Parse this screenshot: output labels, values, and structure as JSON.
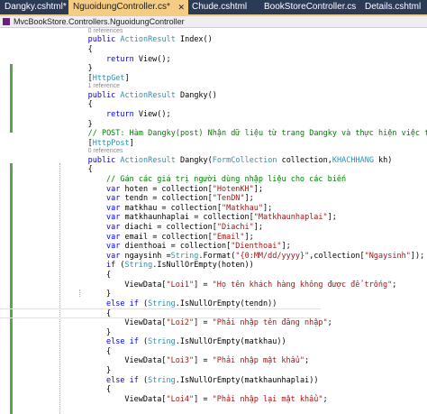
{
  "tabs": [
    {
      "label": "Dangky.cshtml*",
      "active": false
    },
    {
      "label": "NguoidungController.cs*",
      "active": true
    },
    {
      "label": "Chude.cshtml",
      "active": false
    },
    {
      "label": "BookStoreController.cs",
      "active": false
    },
    {
      "label": "Details.cshtml",
      "active": false
    }
  ],
  "tab_close_icon": "✕",
  "navbar": {
    "class_path": "MvcBookStore.Controllers.NguoidungController",
    "icon": "class-icon"
  },
  "colors": {
    "keyword": "#0000ff",
    "type": "#2b91af",
    "string": "#a31515",
    "comment": "#008000",
    "active_tab": "#f5cc84",
    "tab_bar": "#2b3a55",
    "change_bar": "#57a64a"
  },
  "code_lines": [
    {
      "kind": "ref",
      "text": "0 references",
      "indent": 16
    },
    {
      "kind": "code",
      "indent": 16,
      "tokens": [
        [
          "k",
          "public "
        ],
        [
          "t",
          "ActionResult"
        ],
        [
          "p",
          " Index()"
        ]
      ]
    },
    {
      "kind": "code",
      "indent": 16,
      "tokens": [
        [
          "p",
          "{"
        ]
      ]
    },
    {
      "kind": "code",
      "indent": 20,
      "tokens": [
        [
          "k",
          "return "
        ],
        [
          "p",
          "View();"
        ]
      ]
    },
    {
      "kind": "code",
      "indent": 16,
      "tokens": [
        [
          "p",
          "}"
        ]
      ]
    },
    {
      "kind": "code",
      "indent": 16,
      "tokens": [
        [
          "p",
          "["
        ],
        [
          "t",
          "HttpGet"
        ],
        [
          "p",
          "]"
        ]
      ]
    },
    {
      "kind": "ref",
      "text": "1 reference",
      "indent": 16
    },
    {
      "kind": "code",
      "indent": 16,
      "tokens": [
        [
          "k",
          "public "
        ],
        [
          "t",
          "ActionResult"
        ],
        [
          "p",
          " Dangky()"
        ]
      ]
    },
    {
      "kind": "code",
      "indent": 16,
      "tokens": [
        [
          "p",
          "{"
        ]
      ]
    },
    {
      "kind": "code",
      "indent": 20,
      "tokens": [
        [
          "k",
          "return "
        ],
        [
          "p",
          "View();"
        ]
      ]
    },
    {
      "kind": "code",
      "indent": 16,
      "tokens": [
        [
          "p",
          "}"
        ]
      ]
    },
    {
      "kind": "code",
      "indent": 16,
      "tokens": [
        [
          "c",
          "// POST: Hàm Dangky(post) Nhận dữ liệu từ trang Dangky và thực hiện việc tạo mới dữ liệu"
        ]
      ]
    },
    {
      "kind": "code",
      "indent": 16,
      "tokens": [
        [
          "p",
          "["
        ],
        [
          "t",
          "HttpPost"
        ],
        [
          "p",
          "]"
        ]
      ]
    },
    {
      "kind": "ref",
      "text": "0 references",
      "indent": 16
    },
    {
      "kind": "code",
      "indent": 16,
      "tokens": [
        [
          "k",
          "public "
        ],
        [
          "t",
          "ActionResult"
        ],
        [
          "p",
          " Dangky("
        ],
        [
          "t",
          "FormCollection"
        ],
        [
          "p",
          " collection,"
        ],
        [
          "t",
          "KHACHHANG"
        ],
        [
          "p",
          " kh)"
        ]
      ]
    },
    {
      "kind": "code",
      "indent": 16,
      "tokens": [
        [
          "p",
          "{"
        ]
      ]
    },
    {
      "kind": "code",
      "indent": 20,
      "tokens": [
        [
          "c",
          "// Gán các giá trị người dùng nhập liệu cho các biến"
        ]
      ]
    },
    {
      "kind": "code",
      "indent": 20,
      "tokens": [
        [
          "k",
          "var "
        ],
        [
          "p",
          "hoten = collection["
        ],
        [
          "s",
          "\"HotenKH\""
        ],
        [
          "p",
          "];"
        ]
      ]
    },
    {
      "kind": "code",
      "indent": 20,
      "tokens": [
        [
          "k",
          "var "
        ],
        [
          "p",
          "tendn = collection["
        ],
        [
          "s",
          "\"TenDN\""
        ],
        [
          "p",
          "];"
        ]
      ]
    },
    {
      "kind": "code",
      "indent": 20,
      "tokens": [
        [
          "k",
          "var "
        ],
        [
          "p",
          "matkhau = collection["
        ],
        [
          "s",
          "\"Matkhau\""
        ],
        [
          "p",
          "];"
        ]
      ]
    },
    {
      "kind": "code",
      "indent": 20,
      "tokens": [
        [
          "k",
          "var "
        ],
        [
          "p",
          "matkhaunhaplai = collection["
        ],
        [
          "s",
          "\"Matkhaunhaplai\""
        ],
        [
          "p",
          "];"
        ]
      ]
    },
    {
      "kind": "code",
      "indent": 20,
      "tokens": [
        [
          "k",
          "var "
        ],
        [
          "p",
          "diachi = collection["
        ],
        [
          "s",
          "\"Diachi\""
        ],
        [
          "p",
          "];"
        ]
      ]
    },
    {
      "kind": "code",
      "indent": 20,
      "tokens": [
        [
          "k",
          "var "
        ],
        [
          "p",
          "email = collection["
        ],
        [
          "s",
          "\"Email\""
        ],
        [
          "p",
          "];"
        ]
      ]
    },
    {
      "kind": "code",
      "indent": 20,
      "tokens": [
        [
          "k",
          "var "
        ],
        [
          "p",
          "dienthoai = collection["
        ],
        [
          "s",
          "\"Dienthoai\""
        ],
        [
          "p",
          "];"
        ]
      ]
    },
    {
      "kind": "code",
      "indent": 20,
      "tokens": [
        [
          "k",
          "var "
        ],
        [
          "p",
          "ngaysinh ="
        ],
        [
          "t",
          "String"
        ],
        [
          "p",
          ".Format("
        ],
        [
          "s",
          "\"{0:MM/dd/yyyy}\""
        ],
        [
          "p",
          ",collection["
        ],
        [
          "s",
          "\"Ngaysinh\""
        ],
        [
          "p",
          "]);"
        ]
      ]
    },
    {
      "kind": "code",
      "indent": 20,
      "tokens": [
        [
          "k",
          "if "
        ],
        [
          "p",
          "("
        ],
        [
          "t",
          "String"
        ],
        [
          "p",
          ".IsNullOrEmpty(hoten))"
        ]
      ]
    },
    {
      "kind": "code",
      "indent": 20,
      "tokens": [
        [
          "p",
          "{"
        ]
      ]
    },
    {
      "kind": "code",
      "indent": 24,
      "tokens": [
        [
          "p",
          "ViewData["
        ],
        [
          "s",
          "\"Loi1\""
        ],
        [
          "p",
          "] = "
        ],
        [
          "s",
          "\"Họ tên khách hàng không được để trống\""
        ],
        [
          "p",
          ";"
        ]
      ]
    },
    {
      "kind": "code",
      "indent": 20,
      "tokens": [
        [
          "p",
          "}"
        ]
      ]
    },
    {
      "kind": "code",
      "indent": 20,
      "tokens": [
        [
          "k",
          "else if "
        ],
        [
          "p",
          "("
        ],
        [
          "t",
          "String"
        ],
        [
          "p",
          ".IsNullOrEmpty(tendn))"
        ]
      ]
    },
    {
      "kind": "code",
      "indent": 20,
      "current": true,
      "tokens": [
        [
          "p",
          "{"
        ]
      ]
    },
    {
      "kind": "code",
      "indent": 24,
      "tokens": [
        [
          "p",
          "ViewData["
        ],
        [
          "s",
          "\"Loi2\""
        ],
        [
          "p",
          "] = "
        ],
        [
          "s",
          "\"Phải nhập tên đăng nhập\""
        ],
        [
          "p",
          ";"
        ]
      ]
    },
    {
      "kind": "code",
      "indent": 20,
      "tokens": [
        [
          "p",
          "}"
        ]
      ]
    },
    {
      "kind": "code",
      "indent": 20,
      "tokens": [
        [
          "k",
          "else if "
        ],
        [
          "p",
          "("
        ],
        [
          "t",
          "String"
        ],
        [
          "p",
          ".IsNullOrEmpty(matkhau))"
        ]
      ]
    },
    {
      "kind": "code",
      "indent": 20,
      "tokens": [
        [
          "p",
          "{"
        ]
      ]
    },
    {
      "kind": "code",
      "indent": 24,
      "tokens": [
        [
          "p",
          "ViewData["
        ],
        [
          "s",
          "\"Loi3\""
        ],
        [
          "p",
          "] = "
        ],
        [
          "s",
          "\"Phải nhập mật khẩu\""
        ],
        [
          "p",
          ";"
        ]
      ]
    },
    {
      "kind": "code",
      "indent": 20,
      "tokens": [
        [
          "p",
          "}"
        ]
      ]
    },
    {
      "kind": "code",
      "indent": 20,
      "tokens": [
        [
          "k",
          "else if "
        ],
        [
          "p",
          "("
        ],
        [
          "t",
          "String"
        ],
        [
          "p",
          ".IsNullOrEmpty(matkhaunhaplai))"
        ]
      ]
    },
    {
      "kind": "code",
      "indent": 20,
      "tokens": [
        [
          "p",
          "{"
        ]
      ]
    },
    {
      "kind": "code",
      "indent": 24,
      "tokens": [
        [
          "p",
          "ViewData["
        ],
        [
          "s",
          "\"Loi4\""
        ],
        [
          "p",
          "] = "
        ],
        [
          "s",
          "\"Phải nhập lại mật khẩu\""
        ],
        [
          "p",
          ";"
        ]
      ]
    }
  ]
}
